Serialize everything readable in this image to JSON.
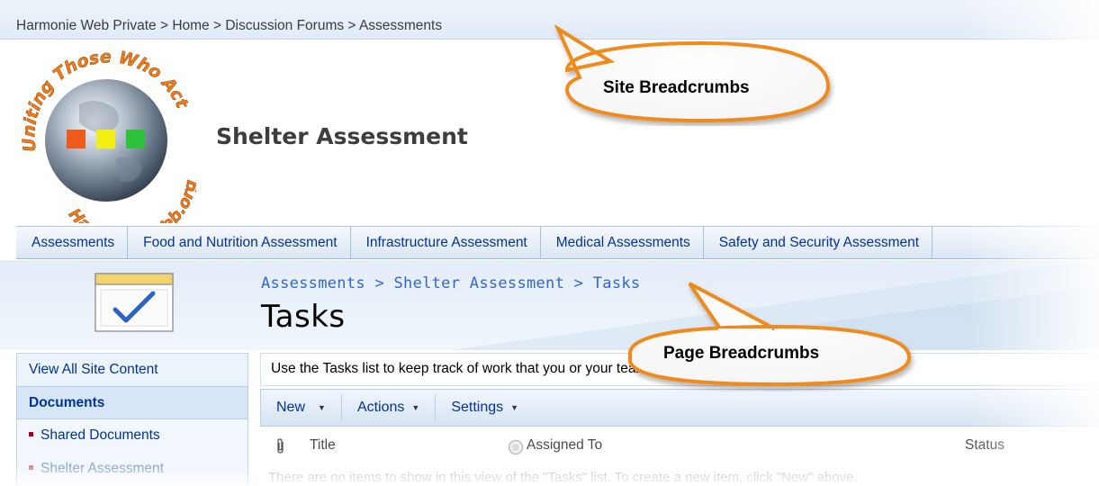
{
  "site_breadcrumb": {
    "items": [
      "Harmonie Web Private",
      "Home",
      "Discussion Forums",
      "Assessments"
    ],
    "separator": " > "
  },
  "logo": {
    "text_top": "Uniting Those Who Act",
    "text_bottom": "Harmonie Web.org"
  },
  "site_title": "Shelter Assessment",
  "top_nav": {
    "tabs": [
      "Assessments",
      "Food and Nutrition Assessment",
      "Infrastructure Assessment",
      "Medical Assessments",
      "Safety and Security Assessment"
    ]
  },
  "page_breadcrumb": {
    "items": [
      "Assessments",
      "Shelter Assessment",
      "Tasks"
    ],
    "separator": " > "
  },
  "page_title": "Tasks",
  "quick_launch": {
    "view_all": "View All Site Content",
    "section_header": "Documents",
    "items": [
      "Shared Documents",
      "Shelter Assessment"
    ]
  },
  "list": {
    "description": "Use the Tasks list to keep track of work that you or your team needs to complete.",
    "toolbar": {
      "new_label": "New",
      "actions_label": "Actions",
      "settings_label": "Settings"
    },
    "columns": {
      "title": "Title",
      "assigned_to": "Assigned To",
      "status": "Status"
    },
    "empty_message": "There are no items to show in this view of the \"Tasks\" list. To create a new item, click \"New\" above."
  },
  "annotations": {
    "site_breadcrumbs": "Site Breadcrumbs",
    "page_breadcrumbs": "Page Breadcrumbs"
  },
  "colors": {
    "link": "#003399",
    "callout_border": "#f08a1c",
    "logo_red": "#f05a1a",
    "logo_yellow": "#f4ee12",
    "logo_green": "#2ec23a"
  }
}
